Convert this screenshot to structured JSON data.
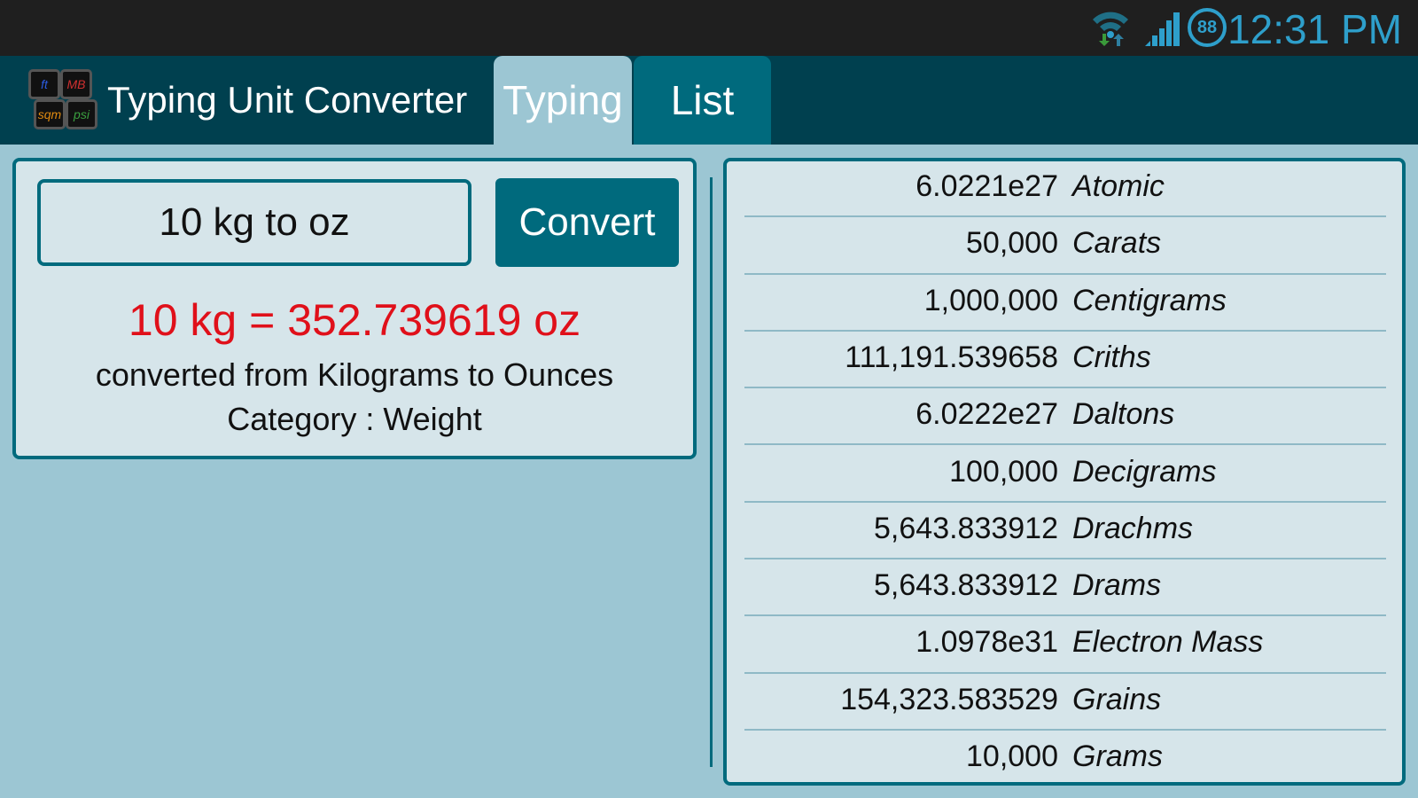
{
  "status_bar": {
    "time": "12:31 PM",
    "battery": "88",
    "icons": [
      "wifi-icon",
      "signal-icon",
      "battery-icon"
    ]
  },
  "header": {
    "title": "Typing Unit Converter",
    "logo_keys": [
      "ft",
      "MB",
      "sqm",
      "psi"
    ],
    "tabs": [
      {
        "label": "Typing",
        "active": true
      },
      {
        "label": "List",
        "active": false
      }
    ]
  },
  "typing": {
    "input_value": "10 kg to oz",
    "convert_label": "Convert",
    "result": "10 kg = 352.739619 oz",
    "description": "converted from Kilograms to Ounces",
    "category": "Category : Weight"
  },
  "list": [
    {
      "value": "6.0221e27",
      "unit": "Atomic"
    },
    {
      "value": "50,000",
      "unit": "Carats"
    },
    {
      "value": "1,000,000",
      "unit": "Centigrams"
    },
    {
      "value": "111,191.539658",
      "unit": "Criths"
    },
    {
      "value": "6.0222e27",
      "unit": "Daltons"
    },
    {
      "value": "100,000",
      "unit": "Decigrams"
    },
    {
      "value": "5,643.833912",
      "unit": "Drachms"
    },
    {
      "value": "5,643.833912",
      "unit": "Drams"
    },
    {
      "value": "1.0978e31",
      "unit": "Electron Mass"
    },
    {
      "value": "154,323.583529",
      "unit": "Grains"
    },
    {
      "value": "10,000",
      "unit": "Grams"
    }
  ]
}
